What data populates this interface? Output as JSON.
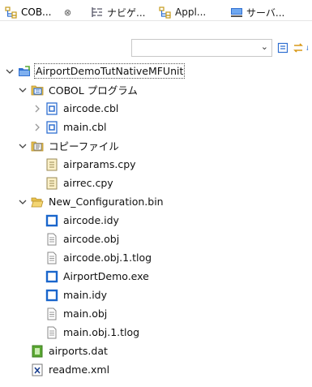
{
  "tabs": [
    {
      "label": "COB...",
      "close": "⊗",
      "active": true
    },
    {
      "label": "ナビゲ...",
      "active": false
    },
    {
      "label": "Appl...",
      "active": false
    },
    {
      "label": "サーバ...",
      "active": false
    }
  ],
  "toolbar": {
    "filter_value": "",
    "buttons": [
      "collapse-all",
      "link-with-editor",
      "sort-alphabetically"
    ]
  },
  "tree": [
    {
      "label": "AirportDemoTutNativeMFUnit",
      "icon": "project-icon",
      "expanded": true,
      "level": 0
    },
    {
      "label": "COBOL プログラム",
      "icon": "cobol-programs-folder-icon",
      "expanded": true,
      "level": 1
    },
    {
      "label": "aircode.cbl",
      "icon": "cobol-file-icon",
      "expanded": false,
      "level": 2
    },
    {
      "label": "main.cbl",
      "icon": "cobol-file-icon",
      "expanded": false,
      "level": 2
    },
    {
      "label": "コピーファイル",
      "icon": "copybook-folder-icon",
      "expanded": true,
      "level": 1
    },
    {
      "label": "airparams.cpy",
      "icon": "copybook-file-icon",
      "level": 2
    },
    {
      "label": "airrec.cpy",
      "icon": "copybook-file-icon",
      "level": 2
    },
    {
      "label": "New_Configuration.bin",
      "icon": "open-folder-icon",
      "expanded": true,
      "level": 1
    },
    {
      "label": "aircode.idy",
      "icon": "blue-square-icon",
      "level": 2
    },
    {
      "label": "aircode.obj",
      "icon": "text-file-icon",
      "level": 2
    },
    {
      "label": "aircode.obj.1.tlog",
      "icon": "text-file-icon",
      "level": 2
    },
    {
      "label": "AirportDemo.exe",
      "icon": "blue-square-icon",
      "level": 2
    },
    {
      "label": "main.idy",
      "icon": "blue-square-icon",
      "level": 2
    },
    {
      "label": "main.obj",
      "icon": "text-file-icon",
      "level": 2
    },
    {
      "label": "main.obj.1.tlog",
      "icon": "text-file-icon",
      "level": 2
    },
    {
      "label": "airports.dat",
      "icon": "data-file-icon",
      "level": 1
    },
    {
      "label": "readme.xml",
      "icon": "xml-file-icon",
      "level": 1
    }
  ],
  "colors": {
    "project_blue": "#2f6fd1",
    "folder_yellow": "#e8c14c",
    "exe_blue": "#1a66cc",
    "green": "#5aa832"
  }
}
